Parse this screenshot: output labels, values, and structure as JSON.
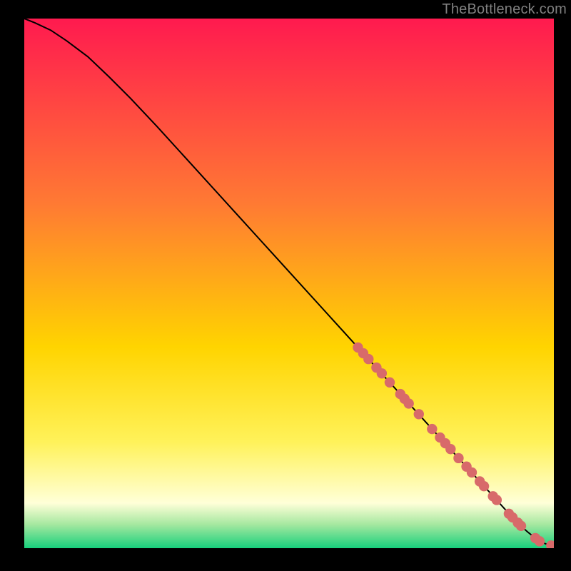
{
  "watermark": "TheBottleneck.com",
  "colors": {
    "frame_bg": "#000000",
    "line": "#000000",
    "marker_fill": "#d86a6a",
    "marker_stroke": "#c84c4c",
    "grad_top": "#ff1a4f",
    "grad_mid1": "#ff7a33",
    "grad_mid2": "#ffd400",
    "grad_mid3": "#fff25a",
    "grad_pale": "#ffffd8",
    "grad_green1": "#a6e8a0",
    "grad_green2": "#17d07c"
  },
  "chart_data": {
    "type": "line",
    "title": "",
    "xlabel": "",
    "ylabel": "",
    "xlim": [
      0,
      100
    ],
    "ylim": [
      0,
      100
    ],
    "series": [
      {
        "name": "curve",
        "x": [
          0,
          2,
          5,
          8,
          12,
          16,
          20,
          25,
          30,
          35,
          40,
          45,
          50,
          55,
          60,
          65,
          70,
          75,
          80,
          85,
          88,
          90,
          91,
          92,
          93,
          94,
          95,
          96,
          97,
          98,
          99,
          100
        ],
        "y": [
          100,
          99.2,
          97.8,
          95.8,
          92.8,
          89.0,
          85.0,
          79.7,
          74.2,
          68.7,
          63.2,
          57.7,
          52.2,
          46.7,
          41.2,
          35.7,
          30.2,
          24.7,
          19.2,
          13.7,
          10.4,
          8.2,
          7.1,
          6.0,
          5.0,
          4.0,
          3.1,
          2.3,
          1.6,
          1.0,
          0.6,
          0.4
        ]
      }
    ],
    "markers": [
      {
        "x": 63.0,
        "y": 37.9
      },
      {
        "x": 64.0,
        "y": 36.8
      },
      {
        "x": 65.0,
        "y": 35.7
      },
      {
        "x": 66.5,
        "y": 34.1
      },
      {
        "x": 67.5,
        "y": 33.0
      },
      {
        "x": 69.0,
        "y": 31.3
      },
      {
        "x": 71.0,
        "y": 29.1
      },
      {
        "x": 71.8,
        "y": 28.2
      },
      {
        "x": 72.6,
        "y": 27.3
      },
      {
        "x": 74.5,
        "y": 25.3
      },
      {
        "x": 77.0,
        "y": 22.5
      },
      {
        "x": 78.5,
        "y": 20.9
      },
      {
        "x": 79.5,
        "y": 19.8
      },
      {
        "x": 80.5,
        "y": 18.7
      },
      {
        "x": 82.0,
        "y": 17.0
      },
      {
        "x": 83.5,
        "y": 15.4
      },
      {
        "x": 84.5,
        "y": 14.3
      },
      {
        "x": 86.0,
        "y": 12.6
      },
      {
        "x": 86.8,
        "y": 11.7
      },
      {
        "x": 88.5,
        "y": 9.8
      },
      {
        "x": 89.2,
        "y": 9.1
      },
      {
        "x": 91.5,
        "y": 6.5
      },
      {
        "x": 92.2,
        "y": 5.8
      },
      {
        "x": 93.2,
        "y": 4.8
      },
      {
        "x": 93.8,
        "y": 4.2
      },
      {
        "x": 96.5,
        "y": 1.9
      },
      {
        "x": 97.3,
        "y": 1.3
      },
      {
        "x": 99.5,
        "y": 0.5
      },
      {
        "x": 100.0,
        "y": 0.4
      }
    ]
  }
}
